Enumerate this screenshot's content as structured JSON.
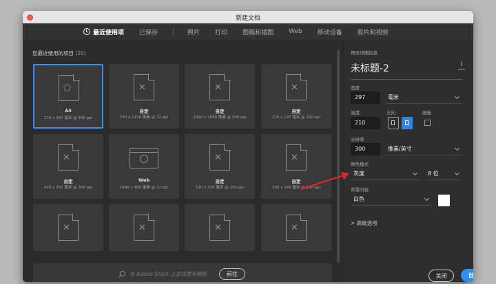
{
  "window": {
    "title": "新建文档"
  },
  "tabs": [
    {
      "label": "最近使用项",
      "active": true
    },
    {
      "label": "已保存"
    },
    {
      "label": "照片"
    },
    {
      "label": "打印"
    },
    {
      "label": "图稿和插图"
    },
    {
      "label": "Web"
    },
    {
      "label": "移动设备"
    },
    {
      "label": "胶片和视频"
    }
  ],
  "recent": {
    "title": "您最近使用的项目",
    "count": "(20)",
    "items": [
      {
        "name": "A4",
        "sub": "210 x 297 毫米 @ 300 ppi",
        "icon": "shape-doc-icon"
      },
      {
        "name": "自定",
        "sub": "780 x 1108 像素 @ 72 ppi",
        "icon": "doc-icon"
      },
      {
        "name": "自定",
        "sub": "1920 x 1080 像素 @ 300 ppi",
        "icon": "doc-icon"
      },
      {
        "name": "自定",
        "sub": "210 x 297 毫米 @ 150 ppi",
        "icon": "doc-icon"
      },
      {
        "name": "自定",
        "sub": "420 x 297 毫米 @ 300 ppi",
        "icon": "doc-icon"
      },
      {
        "name": "Web",
        "sub": "1440 x 900 像素 @ 72 ppi",
        "icon": "web-icon"
      },
      {
        "name": "自定",
        "sub": "120 x 220 厘米 @ 150 ppi",
        "icon": "doc-icon"
      },
      {
        "name": "自定",
        "sub": "100 x 300 厘米 @ 150 ppi",
        "icon": "doc-icon"
      },
      {
        "name": "",
        "sub": "",
        "icon": "doc-icon"
      },
      {
        "name": "",
        "sub": "",
        "icon": "doc-icon"
      },
      {
        "name": "",
        "sub": "",
        "icon": "doc-icon"
      },
      {
        "name": "",
        "sub": "",
        "icon": "doc-icon"
      }
    ]
  },
  "search": {
    "placeholder": "在 Adobe Stock 上查找更多模板",
    "go_label": "前往"
  },
  "preset": {
    "header": "预设详细信息",
    "doc_name": "未标题-2",
    "width_label": "宽度",
    "width_value": "297",
    "width_unit": "毫米",
    "height_label": "高度",
    "height_value": "210",
    "orientation_label": "方向",
    "artboard_label": "画板",
    "resolution_label": "分辨率",
    "resolution_value": "300",
    "resolution_unit": "像素/英寸",
    "color_mode_label": "颜色模式",
    "color_mode_value": "灰度",
    "bit_depth_value": "8 位",
    "background_label": "背景内容",
    "background_value": "白色",
    "background_swatch": "#ffffff",
    "advanced_label": "> 高级选项"
  },
  "buttons": {
    "close_label": "关闭",
    "create_label": "创建"
  },
  "colors": {
    "accent": "#2e8ef2",
    "annotation_arrow": "#e0262a"
  }
}
